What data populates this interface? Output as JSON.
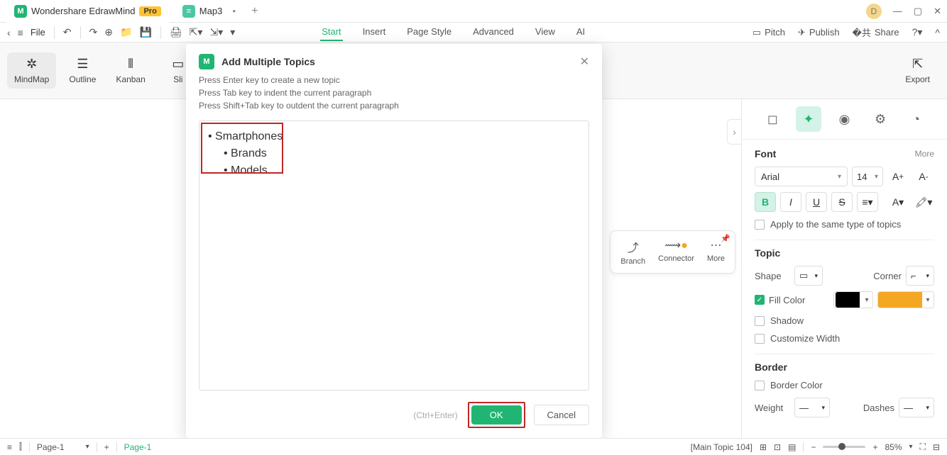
{
  "titlebar": {
    "app_name": "Wondershare EdrawMind",
    "pro_label": "Pro",
    "tab2": "Map3",
    "user_initial": "D"
  },
  "menubar": {
    "file": "File",
    "tabs": [
      "Start",
      "Insert",
      "Page Style",
      "Advanced",
      "View",
      "AI"
    ],
    "active_tab": "Start",
    "pitch": "Pitch",
    "publish": "Publish",
    "share": "Share"
  },
  "ribbon": {
    "items": [
      "MindMap",
      "Outline",
      "Kanban",
      "Sli"
    ],
    "floating_branch": "Branch",
    "floating_connector": "Connector",
    "floating_more": "More",
    "export": "Export"
  },
  "right_panel": {
    "font_title": "Font",
    "more": "More",
    "font_family": "Arial",
    "font_size": "14",
    "apply_same": "Apply to the same type of topics",
    "topic_title": "Topic",
    "shape": "Shape",
    "corner": "Corner",
    "fill_color": "Fill Color",
    "shadow": "Shadow",
    "customize_width": "Customize Width",
    "border_title": "Border",
    "border_color": "Border Color",
    "weight": "Weight",
    "dashes": "Dashes"
  },
  "modal": {
    "title": "Add Multiple Topics",
    "hint1": "Press Enter key to create a new topic",
    "hint2": "Press Tab key to indent the current paragraph",
    "hint3": "Press Shift+Tab key to outdent the current paragraph",
    "line1": "Smartphones",
    "line2": "Brands",
    "line3": "Models",
    "shortcut": "(Ctrl+Enter)",
    "ok": "OK",
    "cancel": "Cancel"
  },
  "statusbar": {
    "page_select": "Page-1",
    "page_label": "Page-1",
    "topic_info": "[Main Topic 104]",
    "zoom": "85%"
  }
}
